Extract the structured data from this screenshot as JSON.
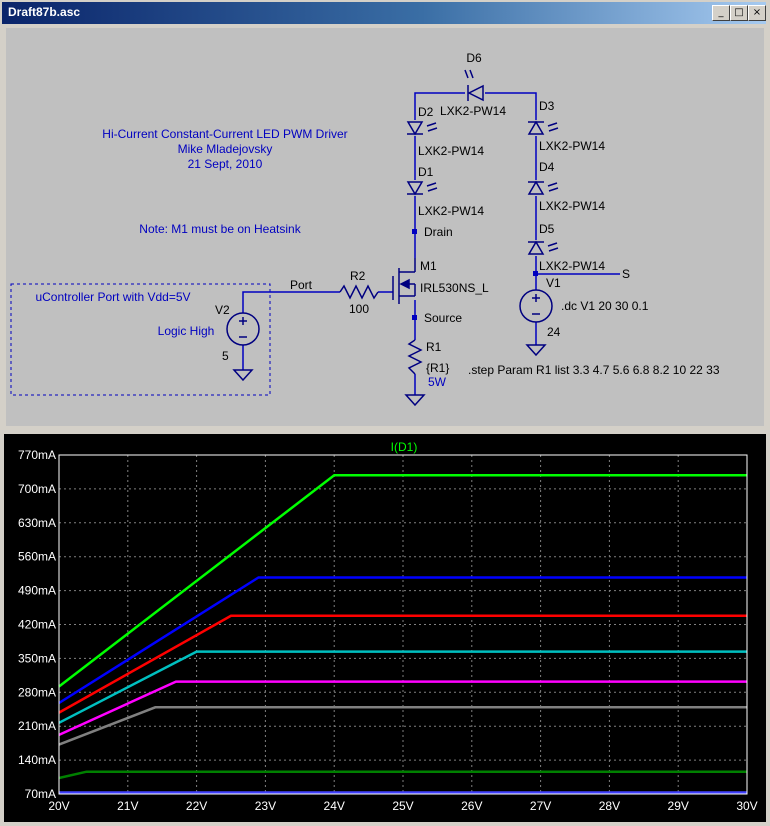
{
  "window": {
    "title": "Draft87b.asc",
    "buttons": {
      "minimize": "_",
      "maximize": "□",
      "close": "×"
    }
  },
  "schematic": {
    "notes": {
      "title_line1": "Hi-Current Constant-Current LED PWM Driver",
      "title_line2": "Mike Mladejovsky",
      "title_line3": "21 Sept, 2010",
      "heatsink_note": "Note: M1 must be on Heatsink",
      "controller_box": "uController Port with Vdd=5V",
      "logic_high": "Logic High"
    },
    "components": {
      "d6_name": "D6",
      "d6_model": "LXK2-PW14",
      "d2_name": "D2",
      "d2_model": "LXK2-PW14",
      "d1_name": "D1",
      "d1_model": "LXK2-PW14",
      "d3_name": "D3",
      "d3_model": "LXK2-PW14",
      "d4_name": "D4",
      "d4_model": "LXK2-PW14",
      "d5_name": "D5",
      "d5_model": "LXK2-PW14",
      "m1_name": "M1",
      "m1_model": "IRL530NS_L",
      "r2_name": "R2",
      "r2_value": "100",
      "r1_name": "R1",
      "r1_value": "{R1}",
      "r1_power": "5W",
      "v1_name": "V1",
      "v1_value": "24",
      "v2_name": "V2",
      "v2_value": "5"
    },
    "net_labels": {
      "drain": "Drain",
      "source": "Source",
      "port": "Port",
      "s": "S"
    },
    "directives": {
      "dc": ".dc V1 20 30 0.1",
      "step": ".step Param R1 list 3.3 4.7 5.6 6.8 8.2 10 22 33"
    }
  },
  "chart_data": {
    "type": "line",
    "title": "I(D1)",
    "xlabel": "",
    "ylabel": "",
    "xlim": [
      20,
      30
    ],
    "ylim": [
      70,
      770
    ],
    "x_ticks": [
      "20V",
      "21V",
      "22V",
      "23V",
      "24V",
      "25V",
      "26V",
      "27V",
      "28V",
      "29V",
      "30V"
    ],
    "y_ticks": [
      "70mA",
      "140mA",
      "210mA",
      "280mA",
      "350mA",
      "420mA",
      "490mA",
      "560mA",
      "630mA",
      "700mA",
      "770mA"
    ],
    "grid": true,
    "colors": {
      "title": "#00ff00",
      "axis_text": "#ffffff",
      "grid": "#808080"
    },
    "series": [
      {
        "color": "#00ff00",
        "x": [
          20,
          24.0,
          30
        ],
        "y": [
          292,
          728,
          728
        ]
      },
      {
        "color": "#0000ff",
        "x": [
          20,
          22.9,
          30
        ],
        "y": [
          258,
          517,
          517
        ]
      },
      {
        "color": "#ff0000",
        "x": [
          20,
          22.5,
          30
        ],
        "y": [
          238,
          438,
          438
        ]
      },
      {
        "color": "#00c0c0",
        "x": [
          20,
          22.0,
          30
        ],
        "y": [
          217,
          364,
          364
        ]
      },
      {
        "color": "#ff00ff",
        "x": [
          20,
          21.7,
          30
        ],
        "y": [
          192,
          302,
          302
        ]
      },
      {
        "color": "#808080",
        "x": [
          20,
          21.4,
          30
        ],
        "y": [
          172,
          249,
          249
        ]
      },
      {
        "color": "#008000",
        "x": [
          20,
          20.4,
          30
        ],
        "y": [
          103,
          116,
          116
        ]
      },
      {
        "color": "#4040ff",
        "x": [
          20,
          30
        ],
        "y": [
          73,
          73
        ]
      }
    ]
  }
}
